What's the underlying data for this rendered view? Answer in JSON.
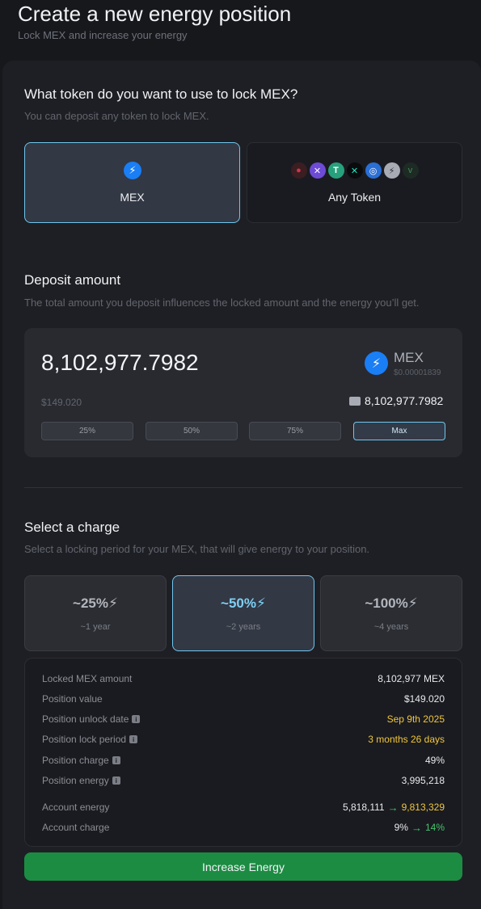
{
  "header": {
    "title": "Create a new energy position",
    "subtitle": "Lock MEX and increase your energy"
  },
  "token_select": {
    "title": "What token do you want to use to lock MEX?",
    "subtitle": "You can deposit any token to lock MEX.",
    "options": [
      {
        "label": "MEX",
        "selected": true,
        "icon": "mex-bolt-icon"
      },
      {
        "label": "Any Token",
        "selected": false,
        "icons": [
          "red-drop-coin-icon",
          "purple-x-coin-icon",
          "tether-coin-icon",
          "black-x-coin-icon",
          "blue-ring-coin-icon",
          "silver-bolt-coin-icon",
          "green-v-coin-icon"
        ]
      }
    ]
  },
  "deposit": {
    "title": "Deposit amount",
    "subtitle": "The total amount you deposit influences the locked amount and the energy you’ll get.",
    "amount": "8,102,977.7982",
    "usd_value": "$149.020",
    "token": "MEX",
    "token_price": "$0.00001839",
    "balance": "8,102,977.7982",
    "percent_buttons": [
      "25%",
      "50%",
      "75%",
      "Max"
    ],
    "active_percent": "Max"
  },
  "charge": {
    "title": "Select a charge",
    "subtitle": "Select a locking period for your MEX, that will give energy to your position.",
    "options": [
      {
        "percent": "~25%",
        "duration": "~1 year",
        "selected": false
      },
      {
        "percent": "~50%",
        "duration": "~2 years",
        "selected": true
      },
      {
        "percent": "~100%",
        "duration": "~4 years",
        "selected": false
      }
    ]
  },
  "summary": {
    "locked_amount_label": "Locked MEX amount",
    "locked_amount_value": "8,102,977 MEX",
    "position_value_label": "Position value",
    "position_value_value": "$149.020",
    "unlock_date_label": "Position unlock date",
    "unlock_date_value": "Sep 9th 2025",
    "lock_period_label": "Position lock period",
    "lock_period_value": "3 months 26 days",
    "position_charge_label": "Position charge",
    "position_charge_value": "49%",
    "position_energy_label": "Position energy",
    "position_energy_value": "3,995,218",
    "account_energy_label": "Account energy",
    "account_energy_from": "5,818,111",
    "account_energy_to": "9,813,329",
    "account_charge_label": "Account charge",
    "account_charge_from": "9%",
    "account_charge_to": "14%"
  },
  "action": {
    "button_label": "Increase Energy"
  },
  "colors": {
    "accent_border": "#6ec6ee",
    "primary_button": "#1c8c43",
    "highlight_yellow": "#f0c63c",
    "positive_green": "#46c36d",
    "mex_blue": "#1a7ef5"
  }
}
